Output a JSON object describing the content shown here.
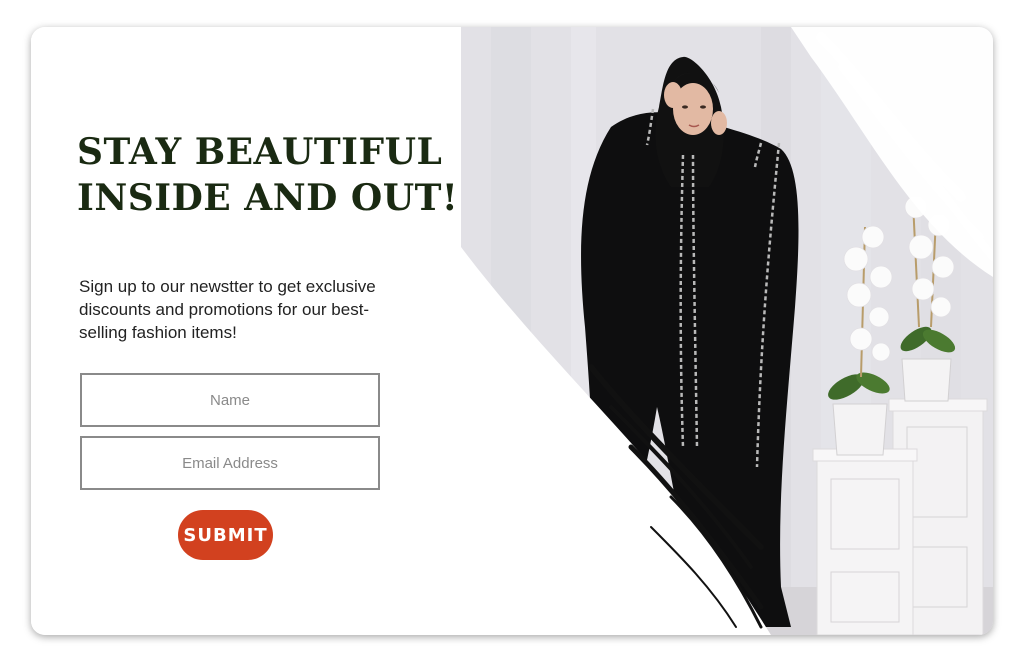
{
  "headline": {
    "line1": "STAY BEAUTIFUL",
    "line2": "INSIDE AND OUT!"
  },
  "subtext": "Sign up to our newstter to get exclusive discounts and promotions for our best-selling fashion items!",
  "form": {
    "name_placeholder": "Name",
    "email_placeholder": "Email Address",
    "submit_label": "SUBMIT"
  },
  "colors": {
    "headline": "#1a2a12",
    "submit": "#d2411f",
    "field_border": "#8a8a8a"
  },
  "image": {
    "subject": "model-in-black-abaya-photo",
    "decor": [
      "white-orchid-plants",
      "white-pedestals",
      "white-brush-strokes"
    ]
  }
}
